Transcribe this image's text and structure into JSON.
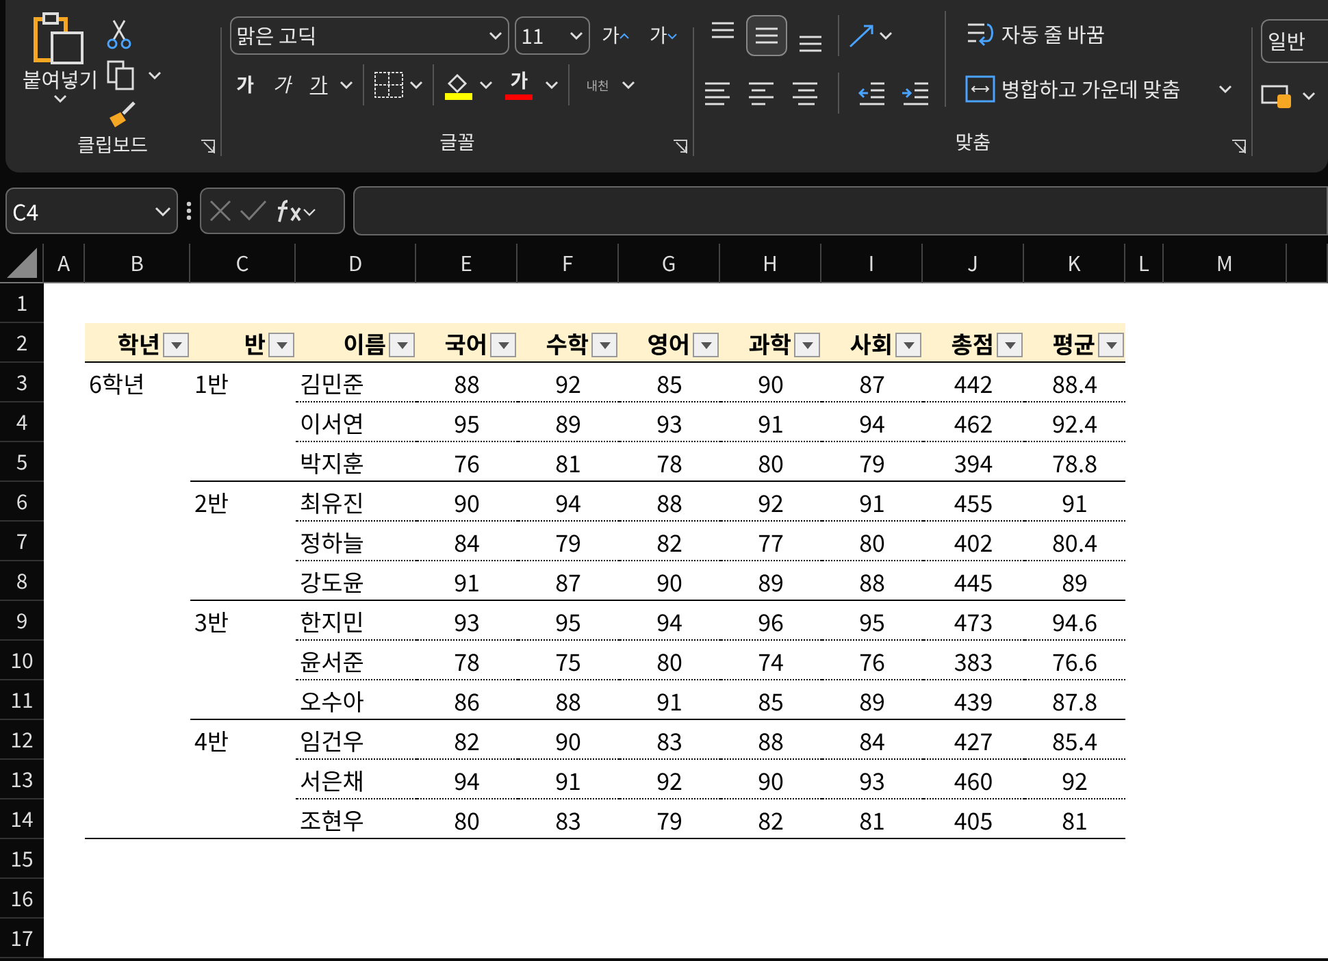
{
  "ribbon": {
    "clipboard": {
      "paste_label": "붙여넣기",
      "group_label": "클립보드"
    },
    "font": {
      "font_name": "맑은 고딕",
      "font_size": "11",
      "grow_label": "가",
      "shrink_label": "가",
      "bold_label": "가",
      "italic_label": "가",
      "underline_label": "가",
      "phonetic_label": "내천",
      "font_color_label": "가",
      "group_label": "글꼴"
    },
    "alignment": {
      "vertical_buttons": [
        {
          "kind": "top",
          "selected": false
        },
        {
          "kind": "middle",
          "selected": true
        },
        {
          "kind": "bottom",
          "selected": false
        }
      ],
      "wrap_label": "자동 줄 바꿈",
      "merge_label": "병합하고 가운데 맞춤",
      "group_label": "맞춤"
    },
    "number": {
      "format": "일반"
    }
  },
  "name_box": "C4",
  "columns": [
    "A",
    "B",
    "C",
    "D",
    "E",
    "F",
    "G",
    "H",
    "I",
    "J",
    "K",
    "L",
    "M"
  ],
  "row_numbers": [
    "1",
    "2",
    "3",
    "4",
    "5",
    "6",
    "7",
    "8",
    "9",
    "10",
    "11",
    "12",
    "13",
    "14",
    "15",
    "16",
    "17"
  ],
  "table": {
    "header": [
      "학년",
      "반",
      "이름",
      "국어",
      "수학",
      "영어",
      "과학",
      "사회",
      "총점",
      "평균"
    ],
    "rows": [
      [
        "6학년",
        "1반",
        "김민준",
        "88",
        "92",
        "85",
        "90",
        "87",
        "442",
        "88.4"
      ],
      [
        "",
        "",
        "이서연",
        "95",
        "89",
        "93",
        "91",
        "94",
        "462",
        "92.4"
      ],
      [
        "",
        "",
        "박지훈",
        "76",
        "81",
        "78",
        "80",
        "79",
        "394",
        "78.8"
      ],
      [
        "",
        "2반",
        "최유진",
        "90",
        "94",
        "88",
        "92",
        "91",
        "455",
        "91"
      ],
      [
        "",
        "",
        "정하늘",
        "84",
        "79",
        "82",
        "77",
        "80",
        "402",
        "80.4"
      ],
      [
        "",
        "",
        "강도윤",
        "91",
        "87",
        "90",
        "89",
        "88",
        "445",
        "89"
      ],
      [
        "",
        "3반",
        "한지민",
        "93",
        "95",
        "94",
        "96",
        "95",
        "473",
        "94.6"
      ],
      [
        "",
        "",
        "윤서준",
        "78",
        "75",
        "80",
        "74",
        "76",
        "383",
        "76.6"
      ],
      [
        "",
        "",
        "오수아",
        "86",
        "88",
        "91",
        "85",
        "89",
        "439",
        "87.8"
      ],
      [
        "",
        "4반",
        "임건우",
        "82",
        "90",
        "83",
        "88",
        "84",
        "427",
        "85.4"
      ],
      [
        "",
        "",
        "서은채",
        "94",
        "91",
        "92",
        "90",
        "93",
        "460",
        "92"
      ],
      [
        "",
        "",
        "조현우",
        "80",
        "83",
        "79",
        "82",
        "81",
        "405",
        "81"
      ]
    ]
  }
}
